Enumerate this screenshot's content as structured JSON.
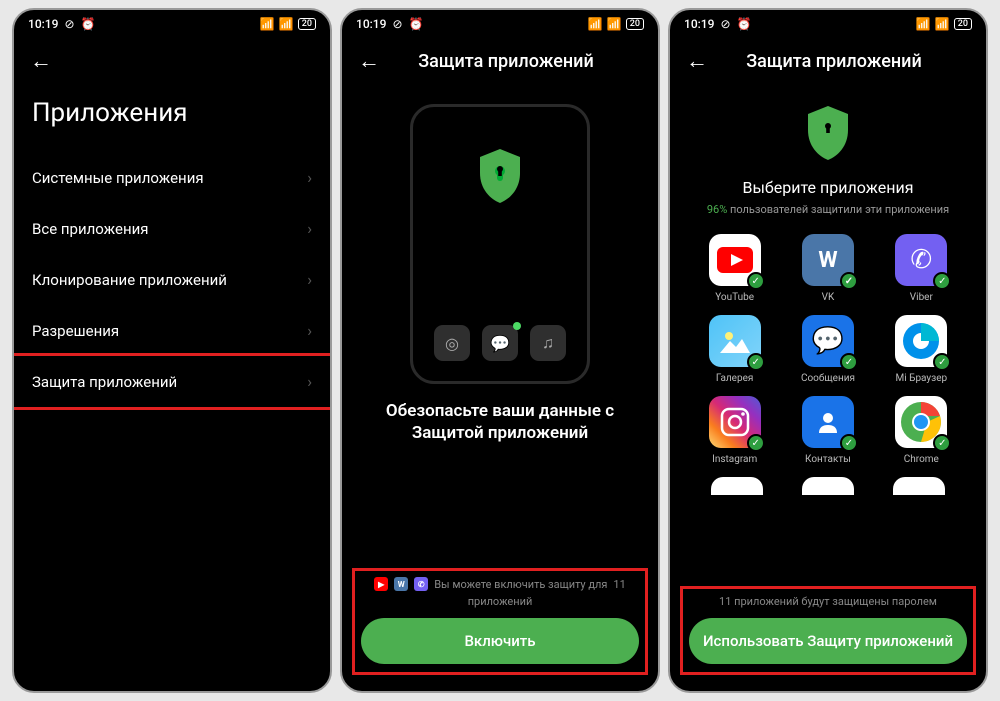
{
  "status": {
    "time": "10:19",
    "battery": "20"
  },
  "screen1": {
    "title": "Приложения",
    "items": [
      {
        "label": "Системные приложения"
      },
      {
        "label": "Все приложения"
      },
      {
        "label": "Клонирование приложений"
      },
      {
        "label": "Разрешения"
      },
      {
        "label": "Защита приложений"
      }
    ]
  },
  "screen2": {
    "header": "Защита приложений",
    "promo_line1": "Обезопасьте ваши данные с",
    "promo_line2": "Защитой приложений",
    "hint_pre": "Вы можете включить защиту для",
    "hint_count": "11",
    "hint_post": "приложений",
    "button": "Включить"
  },
  "screen3": {
    "header": "Защита приложений",
    "select_title": "Выберите приложения",
    "percent": "96%",
    "select_sub": "пользователей защитили эти приложения",
    "apps": [
      {
        "name": "YouTube"
      },
      {
        "name": "VK"
      },
      {
        "name": "Viber"
      },
      {
        "name": "Галерея"
      },
      {
        "name": "Сообщения"
      },
      {
        "name": "Mi Браузер"
      },
      {
        "name": "Instagram"
      },
      {
        "name": "Контакты"
      },
      {
        "name": "Chrome"
      }
    ],
    "footer_hint": "11 приложений будут защищены паролем",
    "button": "Использовать Защиту приложений"
  }
}
